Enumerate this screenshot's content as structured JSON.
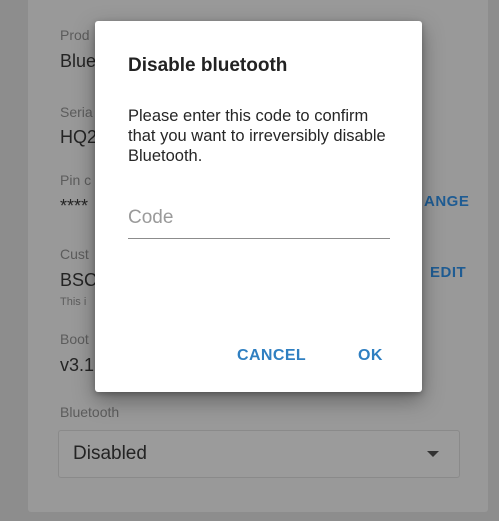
{
  "background": {
    "fields": [
      {
        "label": "Prod",
        "value": "Blue"
      },
      {
        "label": "Seria",
        "value": "HQ2"
      },
      {
        "label": "Pin c",
        "value": "****"
      },
      {
        "label": "Cust",
        "value": "BSC",
        "note": "This i"
      },
      {
        "label": "Boot",
        "value": "v3.1"
      }
    ],
    "change_action": "ANGE",
    "edit_action": "EDIT",
    "bluetooth_label": "Bluetooth",
    "bluetooth_select_value": "Disabled"
  },
  "dialog": {
    "title": "Disable bluetooth",
    "message": "Please enter this code to confirm that you want to irreversibly disable Bluetooth.",
    "code_placeholder": "Code",
    "code_value": "",
    "cancel_label": "CANCEL",
    "ok_label": "OK"
  },
  "colors": {
    "accent": "#2f7fc1",
    "overlay": "#8d8d8d"
  }
}
